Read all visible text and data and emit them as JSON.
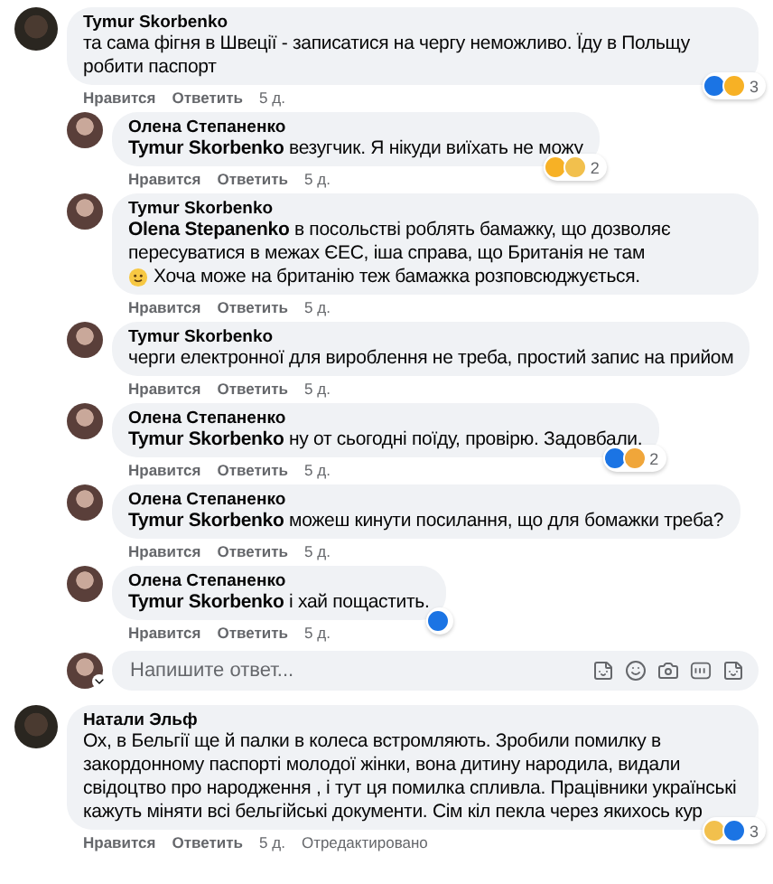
{
  "comments": [
    {
      "author": "Tymur Skorbenko",
      "body": "та сама фігня в Швеції - записатися на чергу неможливо. Їду в Польщу робити паспорт",
      "reactions": [
        {
          "kind": "like"
        },
        {
          "kind": "wow"
        }
      ],
      "reaction_count": "3",
      "actions": [
        "Нравится",
        "Ответить",
        "5 д."
      ],
      "children": [
        {
          "author": "Олена Степаненко",
          "body": "**Tymur Skorbenko** везугчик. Я нікуди виїхать не можу",
          "reactions": [
            {
              "kind": "wow"
            },
            {
              "kind": "sad"
            }
          ],
          "reaction_count": "2",
          "actions": [
            "Нравится",
            "Ответить",
            "5 д."
          ]
        },
        {
          "author": "Tymur Skorbenko",
          "body": "**Olena Stepanenko** в посольстві роблять бамажку, що дозволяє пересуватися в межах ЄЕС, іша справа, що Британія не там",
          "body_end": "Хоча може на британію теж бамажка розповсюджується.",
          "actions": [
            "Нравится",
            "Ответить",
            "5 д."
          ]
        },
        {
          "author": "Tymur Skorbenko",
          "body": "черги електронної для вироблення не треба, простий запис на прийом",
          "actions": [
            "Нравится",
            "Ответить",
            "5 д."
          ]
        },
        {
          "author": "Олена Степаненко",
          "body": "**Tymur Skorbenko** ну от сьогодні поїду, провірю. Задовбали.",
          "reactions": [
            {
              "kind": "like"
            },
            {
              "kind": "care"
            }
          ],
          "reaction_count": "2",
          "actions": [
            "Нравится",
            "Ответить",
            "5 д."
          ]
        },
        {
          "author": "Олена Степаненко",
          "body": "**Tymur Skorbenko** можеш кинути посилання, що для бомажки треба?",
          "actions": [
            "Нравится",
            "Ответить",
            "5 д."
          ]
        },
        {
          "author": "Олена Степаненко",
          "body": "**Tymur Skorbenko** і хай пощастить.",
          "reactions": [
            {
              "kind": "like"
            }
          ],
          "actions": [
            "Нравится",
            "Ответить",
            "5 д."
          ]
        }
      ],
      "reply_box": {
        "placeholder": "Напишите ответ..."
      }
    },
    {
      "author": "Натали Эльф",
      "body": "Ох, в Бельгії ще й палки в колеса встромляють. Зробили помилку в закордонному паспорті молодої жінки, вона дитину народила, видали свідоцтво про народження , і тут ця помилка спливла. Працівники українські кажуть міняти всі бельгійські документи. Сім кіл пекла через якихось кур",
      "reactions": [
        {
          "kind": "sad"
        },
        {
          "kind": "like"
        }
      ],
      "reaction_count": "3",
      "actions": [
        "Нравится",
        "Ответить",
        "5 д.",
        "Отредактировано"
      ]
    }
  ]
}
